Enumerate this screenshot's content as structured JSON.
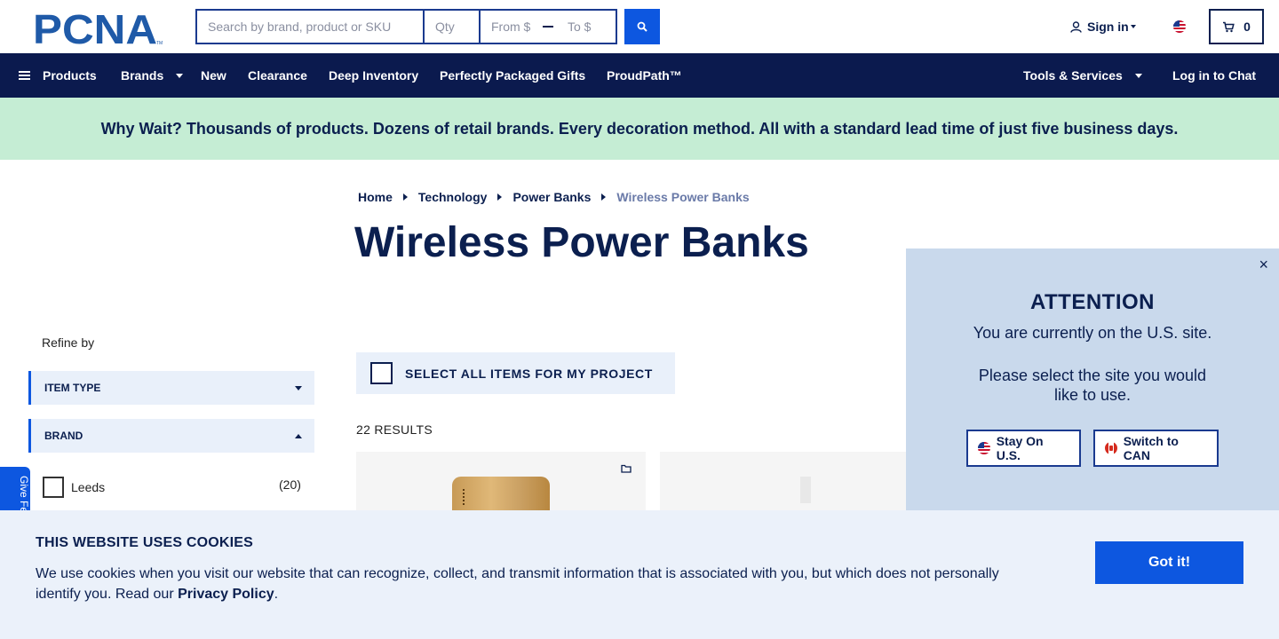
{
  "header": {
    "logo_text": "PCNA",
    "logo_tm": "TM",
    "search": {
      "main_placeholder": "Search by brand, product or SKU",
      "qty_placeholder": "Qty",
      "from_placeholder": "From $",
      "to_placeholder": "To $"
    },
    "sign_in_label": "Sign in",
    "cart_count": "0"
  },
  "nav": {
    "left": [
      {
        "label": "Products",
        "icon": "menu-icon"
      },
      {
        "label": "Brands",
        "dropdown": true
      },
      {
        "label": "New"
      },
      {
        "label": "Clearance"
      },
      {
        "label": "Deep Inventory"
      },
      {
        "label": "Perfectly Packaged Gifts"
      },
      {
        "label": "ProudPath™"
      }
    ],
    "right": [
      {
        "label": "Tools & Services",
        "dropdown": true
      },
      {
        "label": "Log in to Chat"
      }
    ]
  },
  "banner": {
    "text": "Why Wait? Thousands of products. Dozens of retail brands. Every decoration method. All with a standard lead time of just five business days."
  },
  "breadcrumb": [
    "Home",
    "Technology",
    "Power Banks",
    "Wireless Power Banks"
  ],
  "page_title": "Wireless Power Banks",
  "refine": {
    "label": "Refine by",
    "facets": [
      {
        "label": "ITEM TYPE",
        "expanded": false
      },
      {
        "label": "BRAND",
        "expanded": true
      }
    ],
    "brand_options": [
      {
        "label": "Leeds",
        "count": "(20)"
      }
    ]
  },
  "feedback_tab": "Give Fe",
  "products": {
    "select_all_label": "SELECT ALL ITEMS FOR MY PROJECT",
    "results_label": "22 RESULTS"
  },
  "site_modal": {
    "close": "×",
    "title": "ATTENTION",
    "line1": "You are currently on the U.S. site.",
    "line2": "Please select the site you would like to use.",
    "stay_label": "Stay On U.S.",
    "switch_label": "Switch to CAN"
  },
  "cookie": {
    "title": "THIS WEBSITE USES COOKIES",
    "text": "We use cookies when you visit our website that can recognize, collect, and transmit information that is associated with you, but which does not personally identify you. Read our ",
    "link": "Privacy Policy",
    "end": ".",
    "button": "Got it!"
  },
  "colors": {
    "navy": "#0b1a4e",
    "accent_blue": "#0d57e0",
    "banner_green": "#c5edd4",
    "modal_bg": "#c9d9ec",
    "cookie_bg": "#ebf1fa"
  }
}
